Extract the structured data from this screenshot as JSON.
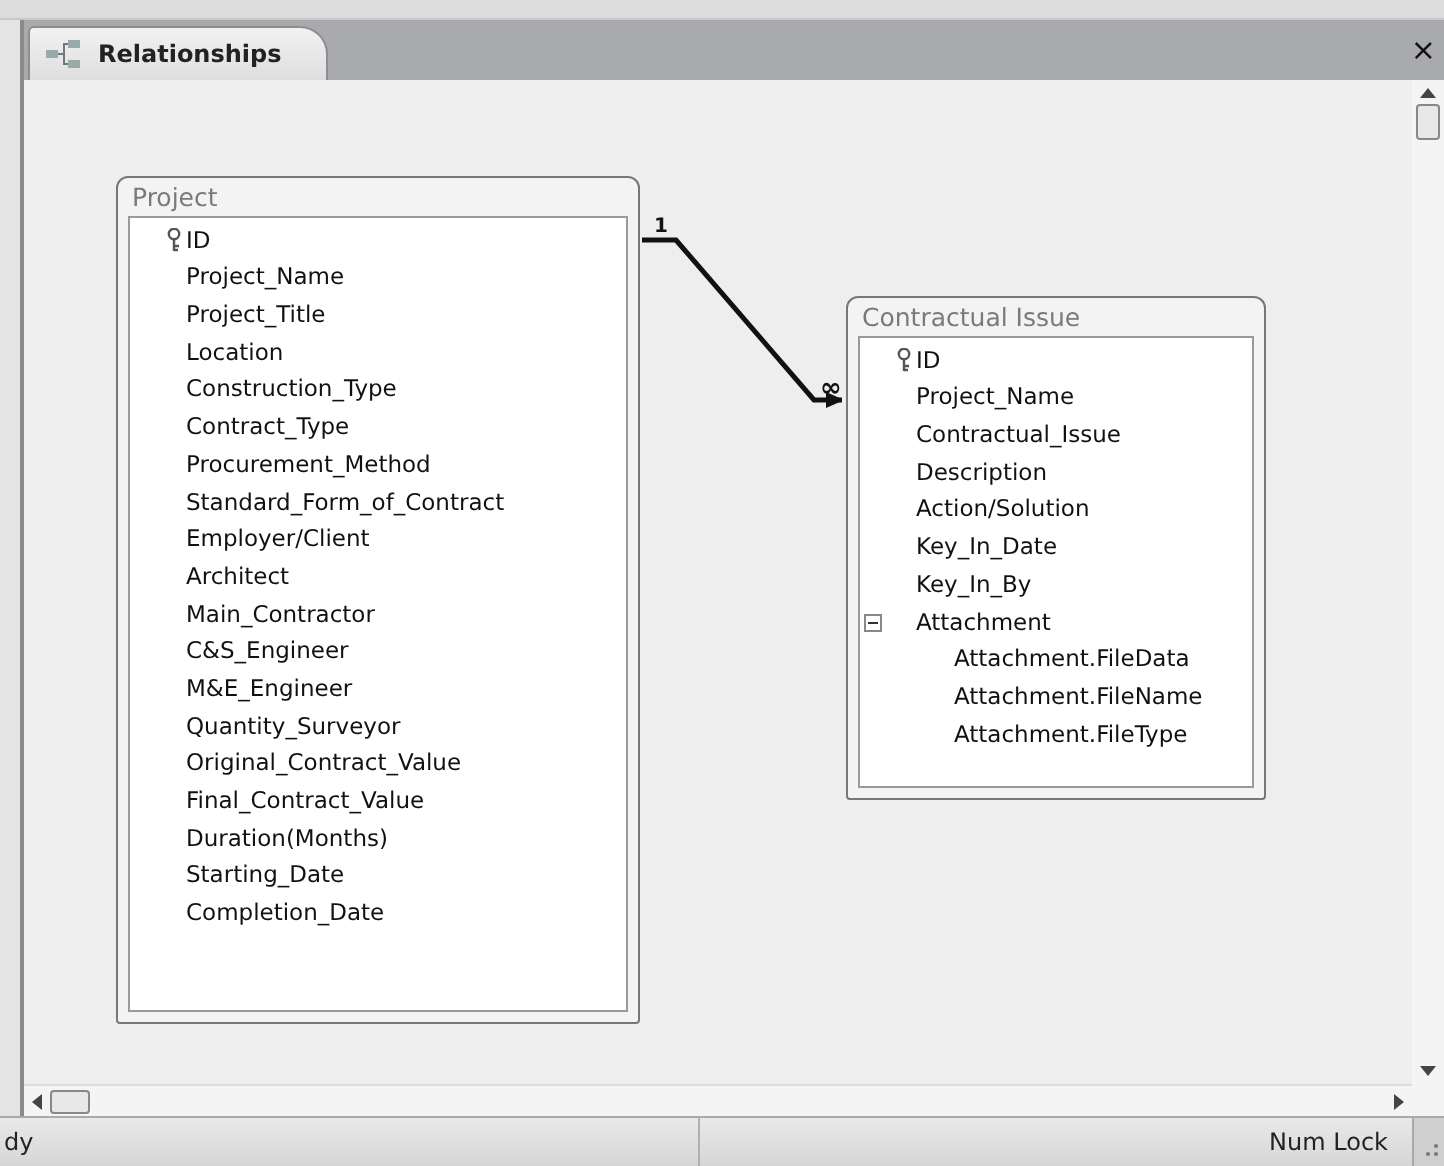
{
  "tab": {
    "title": "Relationships",
    "selected": true
  },
  "close": "×",
  "tables": [
    {
      "title": "Project",
      "fields": [
        {
          "label": "ID",
          "primary_key": true
        },
        {
          "label": "Project_Name"
        },
        {
          "label": "Project_Title"
        },
        {
          "label": "Location"
        },
        {
          "label": "Construction_Type"
        },
        {
          "label": "Contract_Type"
        },
        {
          "label": "Procurement_Method"
        },
        {
          "label": "Standard_Form_of_Contract"
        },
        {
          "label": "Employer/Client"
        },
        {
          "label": "Architect"
        },
        {
          "label": "Main_Contractor"
        },
        {
          "label": "C&S_Engineer"
        },
        {
          "label": "M&E_Engineer"
        },
        {
          "label": "Quantity_Surveyor"
        },
        {
          "label": "Original_Contract_Value"
        },
        {
          "label": "Final_Contract_Value"
        },
        {
          "label": "Duration(Months)"
        },
        {
          "label": "Starting_Date"
        },
        {
          "label": "Completion_Date"
        }
      ]
    },
    {
      "title": "Contractual Issue",
      "fields": [
        {
          "label": "ID",
          "primary_key": true
        },
        {
          "label": "Project_Name"
        },
        {
          "label": "Contractual_Issue"
        },
        {
          "label": "Description"
        },
        {
          "label": "Action/Solution"
        },
        {
          "label": "Key_In_Date"
        },
        {
          "label": "Key_In_By"
        },
        {
          "label": "Attachment",
          "expanded": true,
          "children": [
            {
              "label": "Attachment.FileData"
            },
            {
              "label": "Attachment.FileName"
            },
            {
              "label": "Attachment.FileType"
            }
          ]
        }
      ]
    }
  ],
  "relationship": {
    "one_label": "1",
    "many_label": "∞"
  },
  "status_bar": {
    "left": "dy",
    "right": "Num Lock"
  }
}
